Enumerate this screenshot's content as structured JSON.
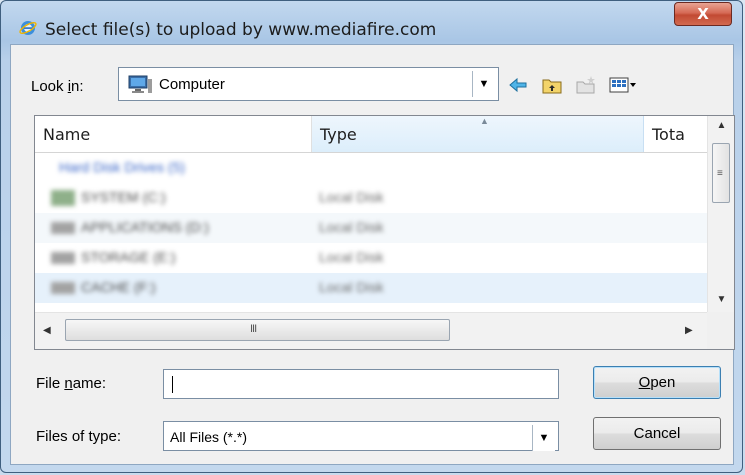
{
  "window": {
    "title": "Select file(s) to upload by www.mediafire.com",
    "close_label": "X"
  },
  "lookin": {
    "label_pre": "Look ",
    "label_accel": "i",
    "label_post": "n:",
    "value": "Computer"
  },
  "toolbar": {
    "icons": [
      "back-arrow-icon",
      "up-folder-icon",
      "new-folder-icon",
      "view-menu-icon"
    ]
  },
  "list": {
    "columns": [
      "Name",
      "Type",
      "Tota"
    ],
    "group_header": "Hard Disk Drives (5)",
    "rows": [
      {
        "name": "SYSTEM (C:)",
        "type": "Local Disk"
      },
      {
        "name": "APPLICATIONS (D:)",
        "type": "Local Disk"
      },
      {
        "name": "STORAGE (E:)",
        "type": "Local Disk"
      },
      {
        "name": "CACHE (F:)",
        "type": "Local Disk"
      }
    ],
    "hscroll_grip": "III"
  },
  "filename": {
    "label_pre": "File ",
    "label_accel": "n",
    "label_post": "ame:",
    "value": ""
  },
  "filetype": {
    "label": "Files of type:",
    "value": "All Files (*.*)"
  },
  "buttons": {
    "open_accel": "O",
    "open_rest": "pen",
    "cancel": "Cancel"
  },
  "colors": {
    "titlebar": "#a9c6e5",
    "close": "#c24a33",
    "client": "#f0f0f0",
    "selected_header": "#dceefb"
  }
}
